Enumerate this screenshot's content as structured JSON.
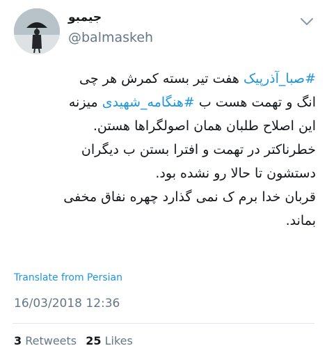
{
  "user": {
    "display_name": "جیمبو",
    "handle": "@balmaskeh"
  },
  "tweet": {
    "lines": [
      [
        {
          "type": "hashtag",
          "text": "#صبا_آذرپیک"
        },
        {
          "type": "text",
          "text": " هفت تیر بسته کمرش هر چی"
        }
      ],
      [
        {
          "type": "text",
          "text": "انگ و تهمت هست ب "
        },
        {
          "type": "hashtag",
          "text": "#هنگامه_شهیدی"
        },
        {
          "type": "text",
          "text": " میزنه"
        }
      ],
      [
        {
          "type": "text",
          "text": "این اصلاح طلبان همان اصولگراها هستن."
        }
      ],
      [
        {
          "type": "text",
          "text": "خطرناکتر در تهمت و افترا بستن ب دیگران"
        }
      ],
      [
        {
          "type": "text",
          "text": "دستشون تا حالا رو نشده بود."
        }
      ],
      [
        {
          "type": "text",
          "text": "قربان خدا برم ک نمی گذارد چهره نفاق مخفی"
        }
      ],
      [
        {
          "type": "text",
          "text": "بماند."
        }
      ]
    ]
  },
  "translate_label": "Translate from Persian",
  "timestamp": "16/03/2018 12:36",
  "stats": {
    "retweets_count": "3",
    "retweets_label": "Retweets",
    "likes_count": "25",
    "likes_label": "Likes"
  },
  "icons": {
    "menu": "chevron-down-icon",
    "avatar": "avatar-image"
  },
  "colors": {
    "link": "#1b95e0",
    "text": "#14171a",
    "muted": "#657786"
  }
}
